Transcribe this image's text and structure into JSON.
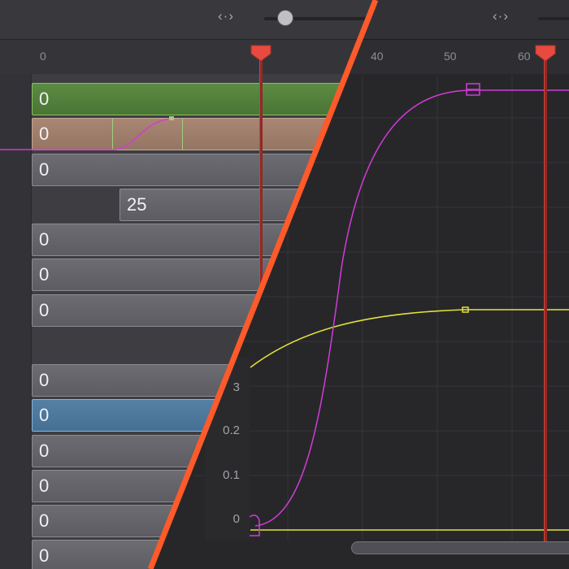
{
  "left_panel": {
    "nav_icon": "‹·›",
    "slider": {
      "value": 0.1
    },
    "ruler": [
      "0"
    ],
    "keyframe_bars": [
      {
        "value": "0",
        "style": "green"
      },
      {
        "value": "0",
        "style": "tan"
      },
      {
        "value": "0",
        "style": "gray"
      },
      {
        "value": "25",
        "style": "gray"
      },
      {
        "value": "0",
        "style": "gray"
      },
      {
        "value": "0",
        "style": "gray"
      },
      {
        "value": "0",
        "style": "gray"
      },
      {
        "value": "0",
        "style": "gray"
      },
      {
        "value": "0",
        "style": "blue"
      },
      {
        "value": "0",
        "style": "gray"
      },
      {
        "value": "0",
        "style": "gray"
      },
      {
        "value": "0",
        "style": "gray"
      },
      {
        "value": "0",
        "style": "gray"
      }
    ],
    "playhead_color": "#e84a3f"
  },
  "right_panel": {
    "nav_icon": "‹·›",
    "ruler": [
      "40",
      "50",
      "60"
    ],
    "y_axis": [
      "3",
      "0.2",
      "0.1",
      "0"
    ],
    "curves": [
      {
        "name": "magenta",
        "color": "#d23bd6"
      },
      {
        "name": "yellow",
        "color": "#e6e23a"
      }
    ],
    "playhead_color": "#e84a3f"
  },
  "colors": {
    "separator": "#ff5a2a",
    "playhead": "#e84a3f"
  }
}
